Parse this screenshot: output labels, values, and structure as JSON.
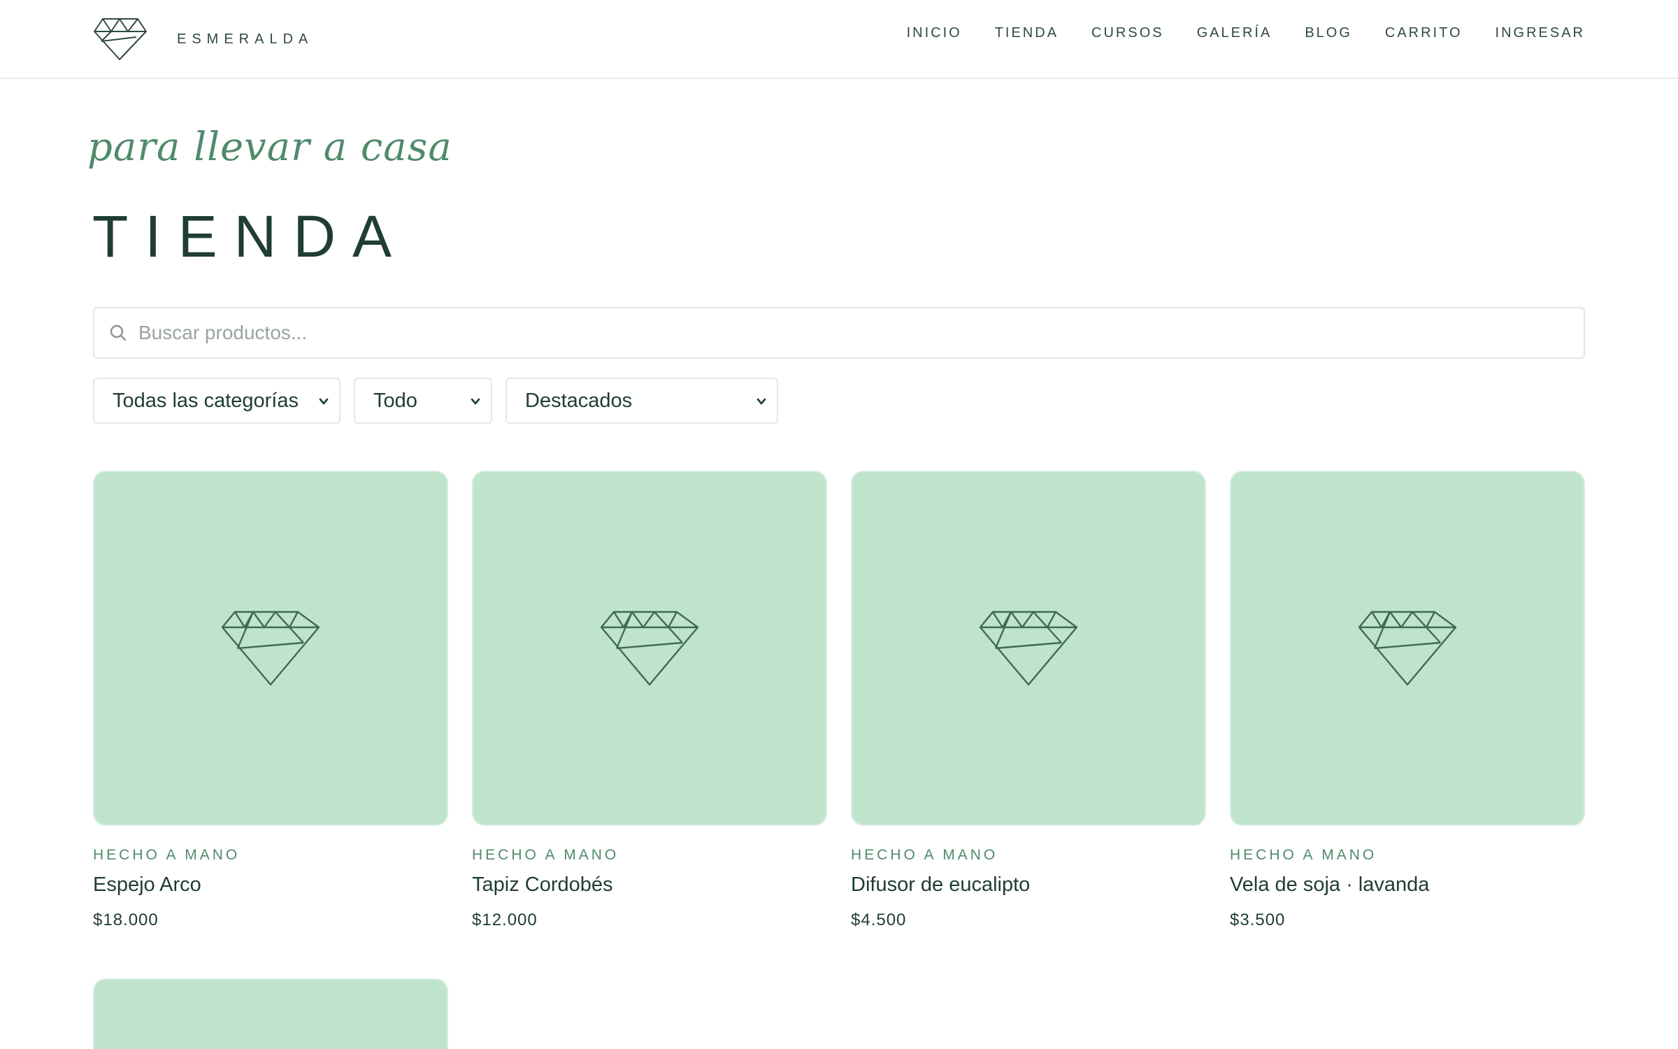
{
  "brand": {
    "name": "ESMERALDA",
    "logo_icon": "heart-gem-logo-icon"
  },
  "nav": {
    "items": [
      {
        "label": "INICIO"
      },
      {
        "label": "TIENDA"
      },
      {
        "label": "CURSOS"
      },
      {
        "label": "GALERÍA"
      },
      {
        "label": "BLOG"
      },
      {
        "label": "CARRITO"
      },
      {
        "label": "INGRESAR"
      }
    ]
  },
  "hero": {
    "tagline": "para llevar a casa",
    "title": "TIENDA"
  },
  "search": {
    "placeholder": "Buscar productos...",
    "value": "",
    "icon": "search-icon"
  },
  "filters": {
    "category": {
      "selected": "Todas las categorías"
    },
    "availability": {
      "selected": "Todo"
    },
    "sort": {
      "selected": "Destacados"
    }
  },
  "products": [
    {
      "category": "HECHO A MANO",
      "name": "Espejo Arco",
      "price": "$18.000"
    },
    {
      "category": "HECHO A MANO",
      "name": "Tapiz Cordobés",
      "price": "$12.000"
    },
    {
      "category": "HECHO A MANO",
      "name": "Difusor de eucalipto",
      "price": "$4.500"
    },
    {
      "category": "HECHO A MANO",
      "name": "Vela de soja · lavanda",
      "price": "$3.500"
    }
  ],
  "colors": {
    "accent": "#4f8a6b",
    "text_dark": "#1f3d30",
    "card_bg": "#bfe4cb",
    "border": "#e3e7e5"
  }
}
